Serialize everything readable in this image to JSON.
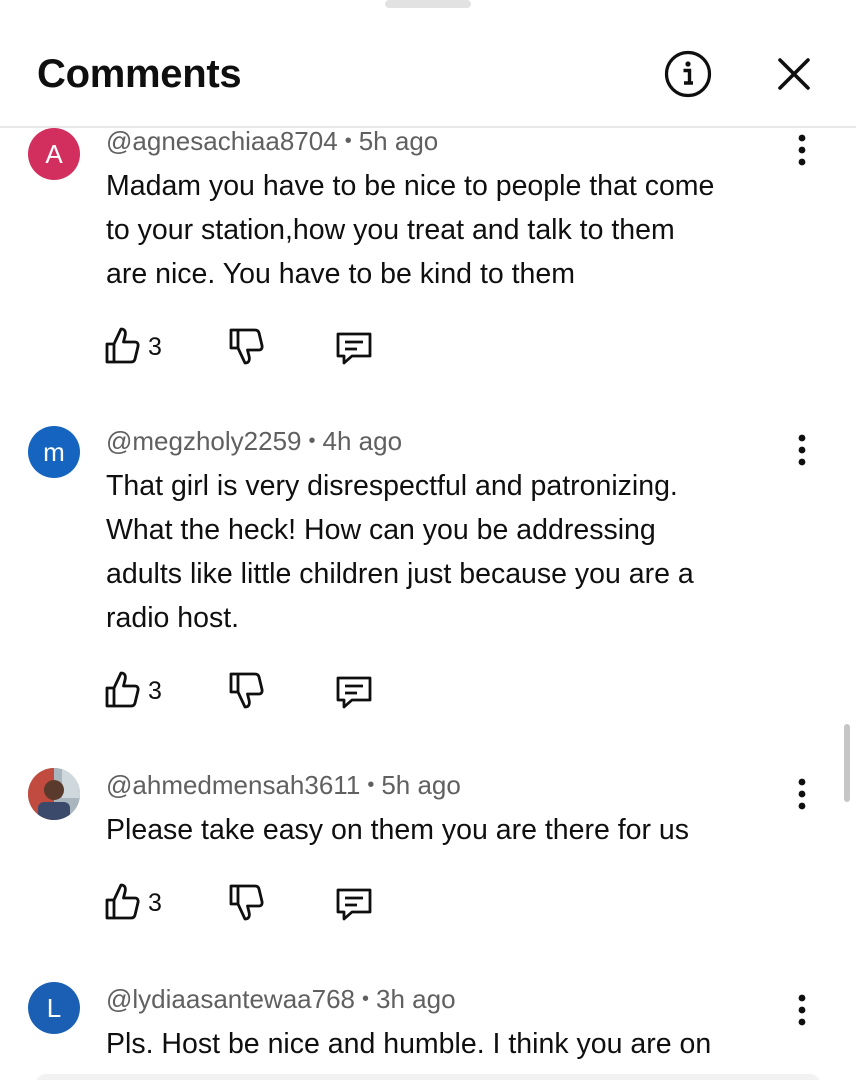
{
  "header": {
    "title": "Comments"
  },
  "colors": {
    "avatar_a": "#d32f5e",
    "avatar_m": "#1565c0",
    "avatar_l": "#1a5fb4",
    "meta_text": "#606060",
    "divider": "#e8e8e8"
  },
  "comments": [
    {
      "avatar_letter": "A",
      "handle": "@agnesachiaa8704",
      "separator": "•",
      "time": "5h ago",
      "lines": [
        "Madam you have to be nice to people that come",
        "to your station,how you treat and talk to them",
        "are nice. You have to be  kind to  them"
      ],
      "likes": "3"
    },
    {
      "avatar_letter": "m",
      "handle": "@megzholy2259",
      "separator": "•",
      "time": "4h ago",
      "lines": [
        "That girl is very disrespectful and patronizing.",
        "What the heck! How can you be addressing",
        "adults like little children just because you are a",
        "radio host."
      ],
      "likes": "3"
    },
    {
      "avatar_letter": "",
      "handle": "@ahmedmensah3611",
      "separator": "•",
      "time": "5h ago",
      "lines": [
        "Please  take easy on them  you are there for us"
      ],
      "likes": "3"
    },
    {
      "avatar_letter": "L",
      "handle": "@lydiaasantewaa768",
      "separator": "•",
      "time": "3h ago",
      "lines": [
        "Pls. Host be nice and humble. I think you are on"
      ],
      "likes": ""
    }
  ]
}
